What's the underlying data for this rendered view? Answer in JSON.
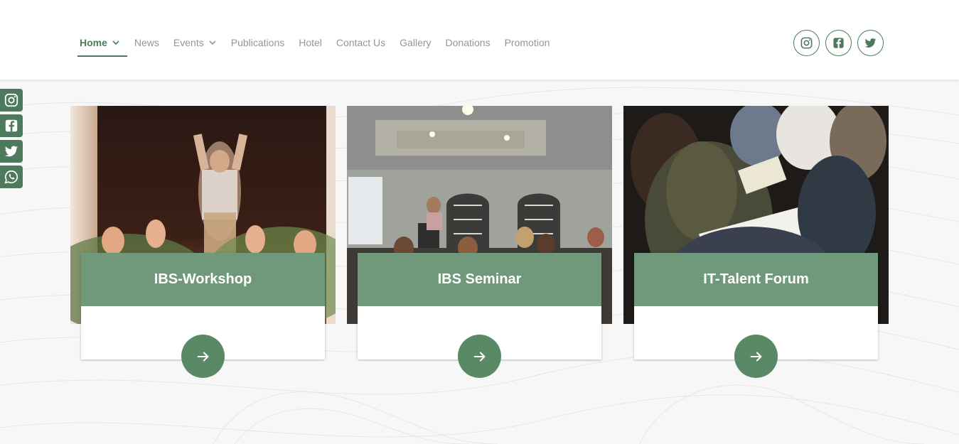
{
  "nav": {
    "items": [
      {
        "label": "Home",
        "has_dropdown": true,
        "active": true
      },
      {
        "label": "News",
        "has_dropdown": false
      },
      {
        "label": "Events",
        "has_dropdown": true
      },
      {
        "label": "Publications",
        "has_dropdown": false
      },
      {
        "label": "Hotel",
        "has_dropdown": false
      },
      {
        "label": "Contact Us",
        "has_dropdown": false
      },
      {
        "label": "Gallery",
        "has_dropdown": false
      },
      {
        "label": "Donations",
        "has_dropdown": false
      },
      {
        "label": "Promotion",
        "has_dropdown": false
      }
    ]
  },
  "header_socials": [
    "instagram-icon",
    "facebook-icon",
    "twitter-icon"
  ],
  "side_socials": [
    "instagram-icon",
    "facebook-icon",
    "twitter-icon",
    "whatsapp-icon"
  ],
  "cards": [
    {
      "title": "IBS-Workshop",
      "image": "workshop-photo"
    },
    {
      "title": "IBS Seminar",
      "image": "seminar-photo"
    },
    {
      "title": "IT-Talent Forum",
      "image": "forum-photo"
    }
  ],
  "colors": {
    "accent": "#4d7a5c",
    "title_overlay": "#588764",
    "nav_text": "#8f9a8f"
  }
}
